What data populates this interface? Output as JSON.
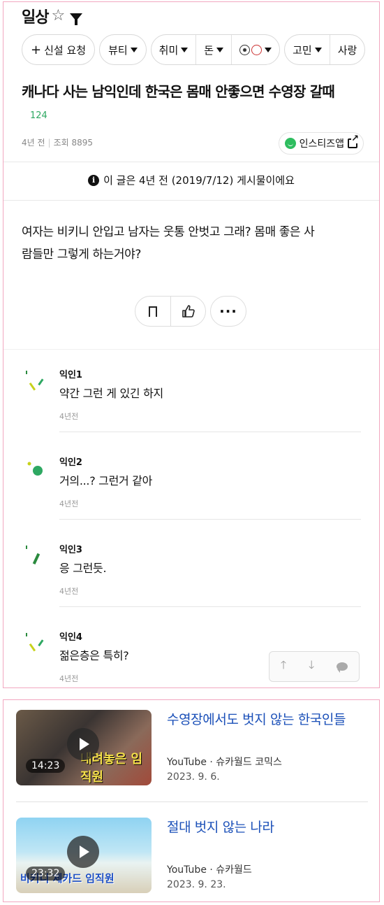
{
  "header": {
    "board_title": "일상",
    "star_glyph": "☆"
  },
  "chips": {
    "request": "신설 요청",
    "beauty": "뷰티",
    "hobby": "취미",
    "money": "돈",
    "gomin": "고민",
    "partial": "사랑"
  },
  "post": {
    "title": "캐나다 사는 남익인데 한국은 몸매 안좋으면 수영장 갈때",
    "likes": "124",
    "time": "4년 전",
    "views": "조회 8895",
    "app_button": "인스티즈앱",
    "notice": "이 글은 4년 전 (2019/7/12) 게시물이에요",
    "body_line1": "여자는 비키니 안입고 남자는 웃통 안벗고 그래? 몸매 좋은 사",
    "body_line2": "람들만 그렇게 하는거야?",
    "more_glyph": "···"
  },
  "comments": [
    {
      "name": "익인1",
      "text": "약간 그런 게 있긴 하지",
      "time": "4년전"
    },
    {
      "name": "익인2",
      "text": "거의...? 그런거 같아",
      "time": "4년전"
    },
    {
      "name": "익인3",
      "text": "응 그런듯.",
      "time": "4년전"
    },
    {
      "name": "익인4",
      "text": "젊은층은 특히?",
      "time": "4년전"
    }
  ],
  "floatnav": {
    "up": "🡑",
    "down": "🡓"
  },
  "videos": [
    {
      "title": "수영장에서도 벗지 않는 한국인들",
      "source": "YouTube · 슈카월드 코믹스",
      "date": "2023. 9. 6.",
      "duration": "14:23",
      "caption": "내려놓은 임직원"
    },
    {
      "title": "절대 벗지 않는 나라",
      "source": "YouTube · 슈카월드",
      "date": "2023. 9. 23.",
      "duration": "23:32",
      "caption": "비키니 체카드 임직원"
    }
  ],
  "colors": {
    "accent_green": "#2ea862",
    "link_blue": "#1a4fb8",
    "frame_pink": "#f2a7c0"
  }
}
